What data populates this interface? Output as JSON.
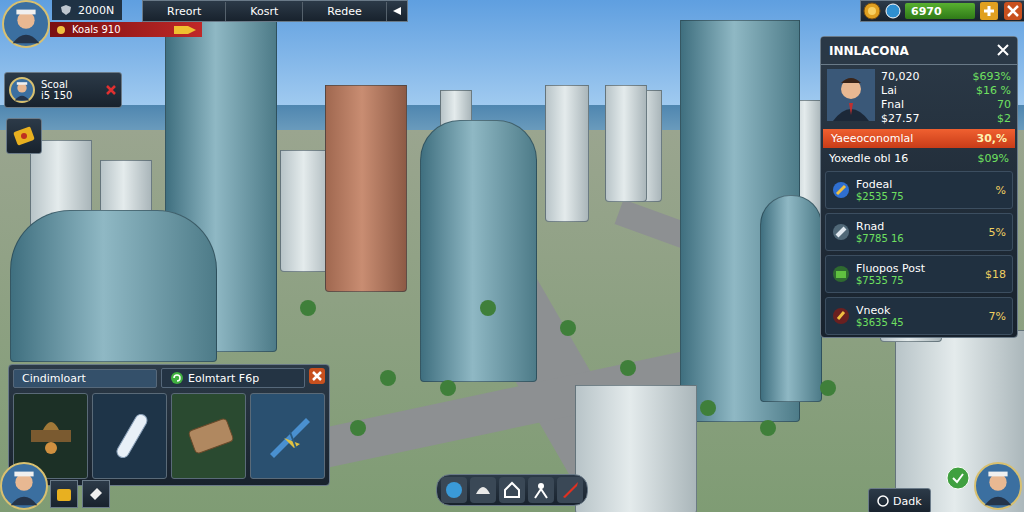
{
  "player": {
    "name": "2000N",
    "rank": "Koals 910"
  },
  "tabs": [
    {
      "label": "Rreort",
      "selected": false
    },
    {
      "label": "Kosrt",
      "selected": false
    },
    {
      "label": "Redee",
      "selected": false
    }
  ],
  "currency": {
    "value": "6970"
  },
  "contact": {
    "name": "Scoal",
    "amount": "i5 150"
  },
  "panel": {
    "title": "INNLACONA",
    "stats": [
      {
        "label": "70,020",
        "value": "$693%"
      },
      {
        "label": "Lai",
        "value": "$16 %"
      },
      {
        "label": "Fnal",
        "value": "70"
      },
      {
        "label": "$27.57",
        "value": "$2"
      }
    ],
    "highlight": {
      "label": "Yaeeoconomlal",
      "value": "30,%"
    },
    "subtitle": {
      "label": "Yoxedle obl 16",
      "value": "$09%"
    },
    "items": [
      {
        "name": "Fodeal",
        "price": "$2535 75",
        "value": "%"
      },
      {
        "name": "Rnad",
        "price": "$7785 16",
        "value": "5%"
      },
      {
        "name": "Fluopos Post",
        "price": "$7535 75",
        "value": "$18"
      },
      {
        "name": "Vneok",
        "price": "$3635 45",
        "value": "7%"
      }
    ]
  },
  "inventory": {
    "tabs": [
      {
        "label": "Cindimloart",
        "selected": true
      },
      {
        "label": "Eolmtart F6p",
        "selected": false
      }
    ],
    "slots": [
      {
        "kind": "lamp"
      },
      {
        "kind": "capsule"
      },
      {
        "kind": "crate"
      },
      {
        "kind": "jet"
      }
    ]
  },
  "footer": {
    "label": "Dadk"
  }
}
